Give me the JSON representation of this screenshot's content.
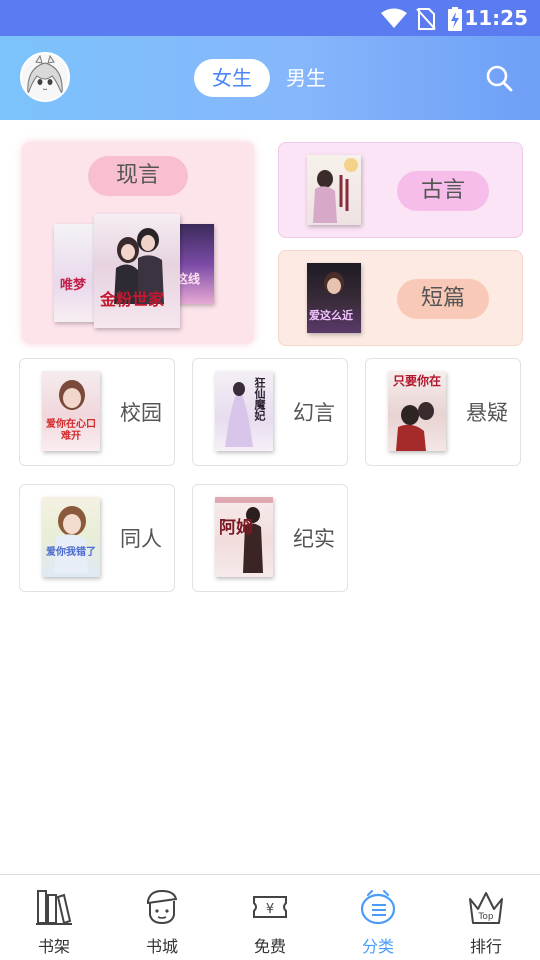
{
  "status_bar": {
    "time": "11:25",
    "icons": [
      "wifi-icon",
      "no-sim-icon",
      "battery-charging-icon"
    ]
  },
  "header": {
    "avatar_icon": "anime-girl-avatar",
    "tabs": [
      {
        "label": "女生",
        "active": true
      },
      {
        "label": "男生",
        "active": false
      }
    ],
    "search_icon": "search-icon"
  },
  "featured": {
    "xianyan": {
      "label": "现言",
      "cover_titles": [
        "唯梦",
        "金粉世家",
        "这线"
      ]
    },
    "guyan": {
      "label": "古言"
    },
    "duanpian": {
      "label": "短篇",
      "cover_title": "爱这么近"
    }
  },
  "categories": [
    {
      "label": "校园",
      "cover_title": "爱你在心口难开"
    },
    {
      "label": "幻言",
      "cover_title": "狂仙魔妃"
    },
    {
      "label": "悬疑",
      "cover_title": "只要你在"
    },
    {
      "label": "同人",
      "cover_title": "爱你我错了"
    },
    {
      "label": "纪实",
      "cover_title": "阿姆"
    }
  ],
  "tabbar": [
    {
      "label": "书架",
      "icon": "bookshelf-icon",
      "active": false
    },
    {
      "label": "书城",
      "icon": "bookstore-icon",
      "active": false
    },
    {
      "label": "免费",
      "icon": "free-ticket-icon",
      "active": false
    },
    {
      "label": "分类",
      "icon": "category-icon",
      "active": true
    },
    {
      "label": "排行",
      "icon": "crown-top-icon",
      "active": false
    }
  ],
  "colors": {
    "accent": "#4a86f5",
    "tab_active": "#4a9cf8",
    "header_start": "#7cc3fb",
    "header_end": "#6f9ff6"
  }
}
